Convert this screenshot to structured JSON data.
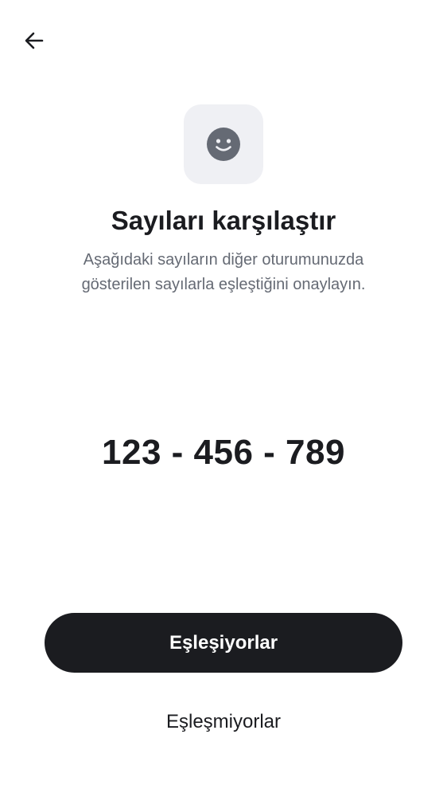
{
  "header": {
    "back_icon": "arrow-left-icon"
  },
  "hero": {
    "icon": "smiley-face-icon",
    "tile_color": "#eff0f4",
    "icon_color": "#656a74"
  },
  "content": {
    "title": "Sayıları karşılaştır",
    "description": "Aşağıdaki sayıların diğer oturumunuzda gösterilen sayılarla eşleştiğini onaylayın.",
    "code": "123 - 456 - 789"
  },
  "actions": {
    "confirm_label": "Eşleşiyorlar",
    "deny_label": "Eşleşmiyorlar"
  },
  "colors": {
    "primary": "#1b1c20",
    "secondary_text": "#656a74",
    "background": "#ffffff"
  }
}
